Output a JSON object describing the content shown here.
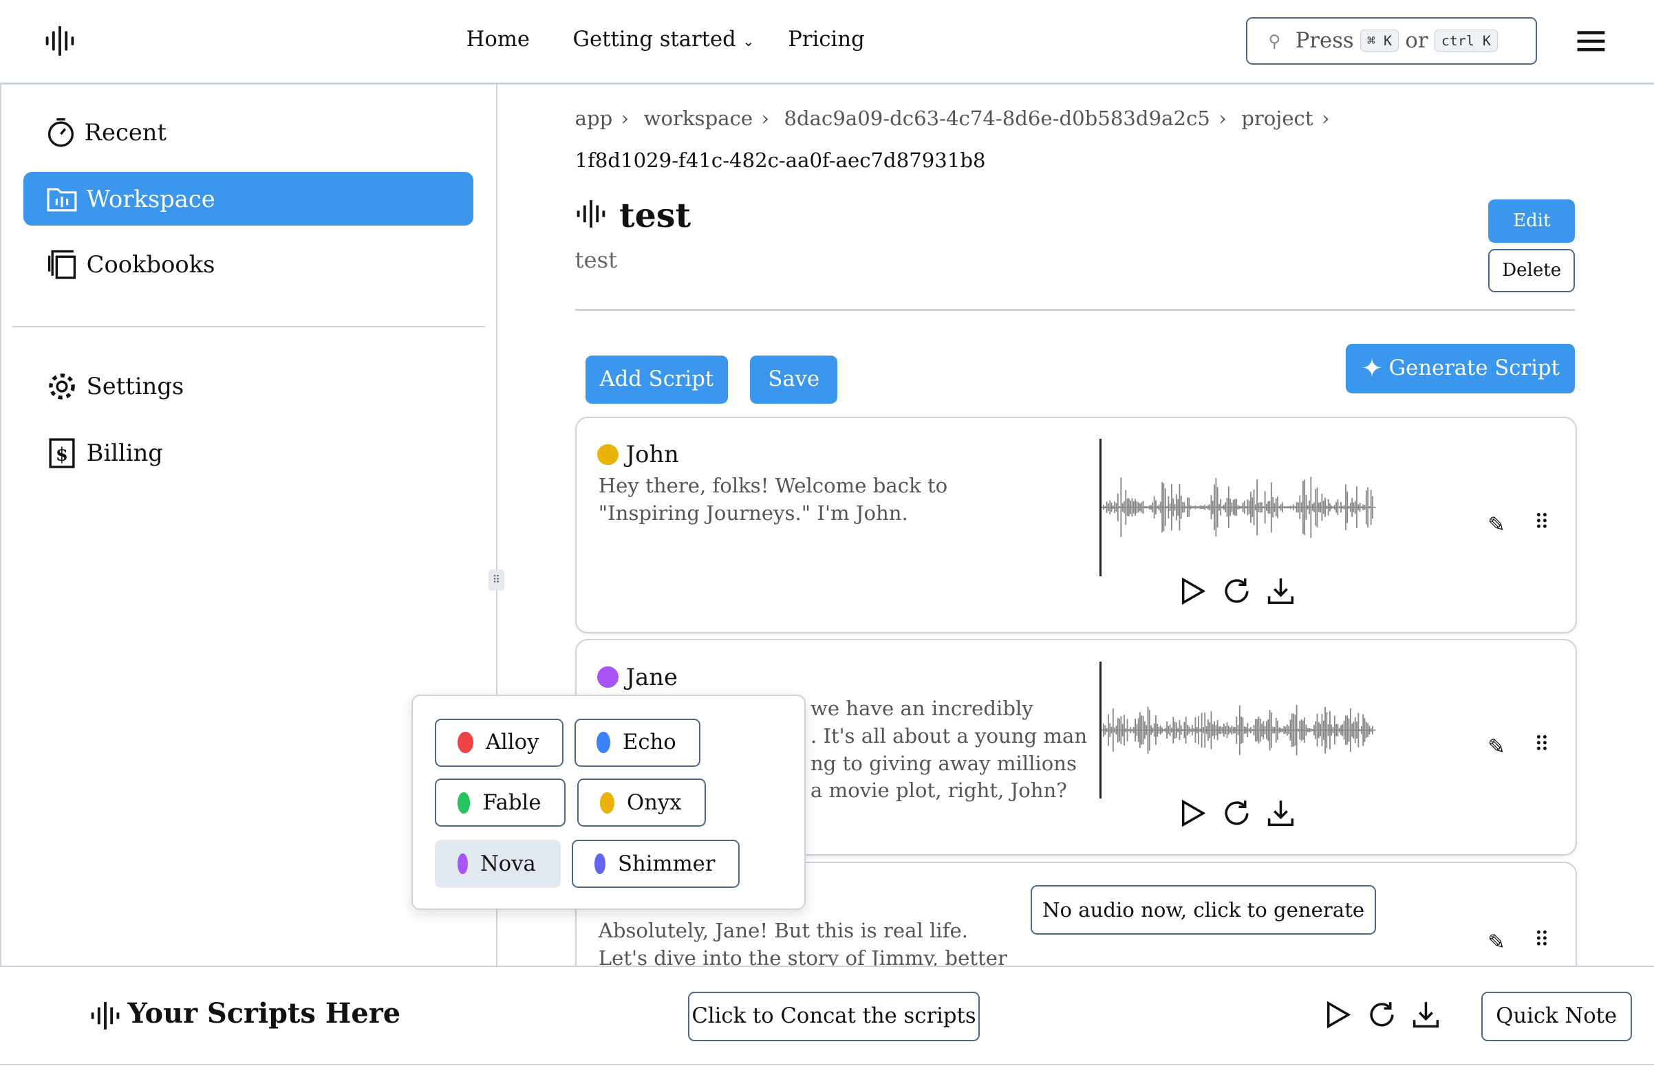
{
  "header": {
    "nav": [
      "Home",
      "Getting started",
      "Pricing"
    ],
    "search": {
      "press": "Press",
      "key1": "⌘ K",
      "or": "or",
      "key2": "ctrl K"
    }
  },
  "sidebar": {
    "items": [
      {
        "label": "Recent",
        "icon": "stopwatch-icon"
      },
      {
        "label": "Workspace",
        "icon": "folder-icon",
        "active": true
      },
      {
        "label": "Cookbooks",
        "icon": "book-icon"
      },
      {
        "label": "Settings",
        "icon": "gear-icon"
      },
      {
        "label": "Billing",
        "icon": "receipt-dollar-icon"
      }
    ]
  },
  "breadcrumb": [
    "app",
    "workspace",
    "8dac9a09-dc63-4c74-8d6e-d0b583d9a2c5",
    "project",
    "1f8d1029-f41c-482c-aa0f-aec7d87931b8"
  ],
  "project": {
    "title": "test",
    "description": "test",
    "edit": "Edit",
    "delete": "Delete"
  },
  "toolbar": {
    "add": "Add Script",
    "save": "Save",
    "generate": "Generate Script"
  },
  "scripts": [
    {
      "speaker": "John",
      "color": "#eab308",
      "text": "Hey there, folks! Welcome back to \"Inspiring Journeys.\" I'm John."
    },
    {
      "speaker": "Jane",
      "color": "#a855f7",
      "text_visible": [
        "we have an incredibly",
        ". It's all about a young man",
        "ng to giving away millions",
        "a movie plot, right, John?"
      ]
    },
    {
      "text": "Absolutely, Jane! But this is real life. Let's dive into the story of Jimmy, better known",
      "no_audio": "No audio now, click to generate"
    }
  ],
  "voices": [
    {
      "name": "Alloy",
      "color": "#ef4444"
    },
    {
      "name": "Echo",
      "color": "#3b82f6"
    },
    {
      "name": "Fable",
      "color": "#22c55e"
    },
    {
      "name": "Onyx",
      "color": "#eab308"
    },
    {
      "name": "Nova",
      "color": "#a855f7",
      "selected": true
    },
    {
      "name": "Shimmer",
      "color": "#6366f1"
    }
  ],
  "footer": {
    "title": "Your Scripts Here",
    "concat": "Click to Concat the scripts",
    "quick_note": "Quick Note"
  }
}
